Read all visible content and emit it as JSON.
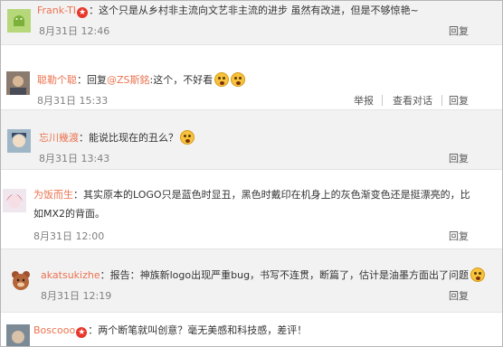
{
  "comments": [
    {
      "user": "Frank-TI",
      "has_vip_badge": true,
      "text": "：这个只是从乡村非主流向文艺非主流的进步 虽然有改进，但是不够惊艳~",
      "time": "8月31日 12:46",
      "actions": [
        "回复"
      ]
    },
    {
      "user": "聪勒个聪",
      "reply_prefix": "：回复",
      "reply_to": "@ZS斯銘",
      "text": ":这个，不好看",
      "emojis": [
        "shocked-face",
        "shocked-face"
      ],
      "time": "8月31日 15:33",
      "actions": [
        "举报",
        "查看对话",
        "回复"
      ]
    },
    {
      "user": "忘川幾渡",
      "text": "：能说比现在的丑么？",
      "emojis": [
        "sleepy-face"
      ],
      "time": "8月31日 13:43",
      "actions": [
        "回复"
      ]
    },
    {
      "user": "为饭而生",
      "text": "：其实原本的LOGO只是蓝色时显丑，黑色时戴印在机身上的灰色渐变色还是挺漂亮的，比",
      "text_line2": "如MX2的背面。",
      "time": "8月31日 12:00",
      "actions": [
        "回复"
      ]
    },
    {
      "user": "akatsukizhe",
      "text": "：报告：神族新logo出现严重bug，书写不连贯，断篇了，估计是油墨方面出了问题",
      "emojis": [
        "smug-face"
      ],
      "time": "8月31日 12:19",
      "actions": [
        "回复"
      ]
    },
    {
      "user": "Boscooo",
      "has_vip_badge": true,
      "text": "：两个断笔就叫创意？毫无美感和科技感，差评！"
    }
  ],
  "star_glyph": "★"
}
